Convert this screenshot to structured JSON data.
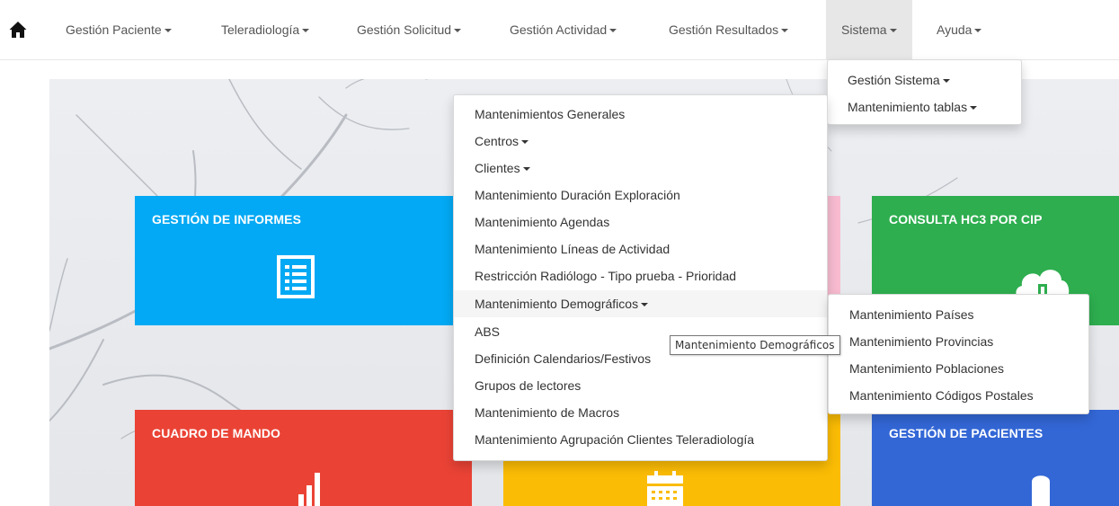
{
  "navbar": {
    "home_icon": "home-icon",
    "items": [
      {
        "label": "Gestión Paciente"
      },
      {
        "label": "Teleradiología"
      },
      {
        "label": "Gestión Solicitud"
      },
      {
        "label": "Gestión Actividad"
      },
      {
        "label": "Gestión Resultados"
      },
      {
        "label": "Sistema"
      },
      {
        "label": "Ayuda"
      }
    ],
    "active_item": "Sistema"
  },
  "sistema_menu": {
    "items": [
      {
        "label": "Gestión Sistema"
      },
      {
        "label": "Mantenimiento tablas"
      }
    ]
  },
  "tablas_menu": {
    "items": [
      {
        "label": "Mantenimientos Generales"
      },
      {
        "label": "Centros"
      },
      {
        "label": "Clientes"
      },
      {
        "label": "Mantenimiento Duración Exploración"
      },
      {
        "label": "Mantenimiento Agendas"
      },
      {
        "label": "Mantenimiento Líneas de Actividad"
      },
      {
        "label": "Restricción Radiólogo - Tipo prueba - Prioridad"
      },
      {
        "label": "Mantenimiento Demográficos"
      },
      {
        "label": "ABS"
      },
      {
        "label": "Definición Calendarios/Festivos"
      },
      {
        "label": "Grupos de lectores"
      },
      {
        "label": "Mantenimiento de Macros"
      },
      {
        "label": "Mantenimiento Agrupación Clientes Teleradiología"
      }
    ],
    "hovered_item": "Mantenimiento Demográficos"
  },
  "demograficos_menu": {
    "items": [
      {
        "label": "Mantenimiento Países"
      },
      {
        "label": "Mantenimiento Provincias"
      },
      {
        "label": "Mantenimiento Poblaciones"
      },
      {
        "label": "Mantenimiento Códigos Postales"
      }
    ]
  },
  "tooltip": {
    "text": "Mantenimiento Demográficos"
  },
  "tiles": [
    {
      "title": "GESTIÓN DE INFORMES",
      "color": "#03a9f4",
      "icon": "list-icon"
    },
    {
      "title": "",
      "color": "#f8bbd0",
      "icon": ""
    },
    {
      "title": "CONSULTA HC3 POR CIP",
      "color": "#2eae4f",
      "icon": "cloud-icon"
    },
    {
      "title": "CUADRO DE MANDO",
      "color": "#ea4335",
      "icon": "bar-chart-icon"
    },
    {
      "title": "",
      "color": "#fbbc05",
      "icon": "calendar-icon"
    },
    {
      "title": "GESTIÓN DE PACIENTES",
      "color": "#3367d6",
      "icon": "user-icon"
    }
  ]
}
